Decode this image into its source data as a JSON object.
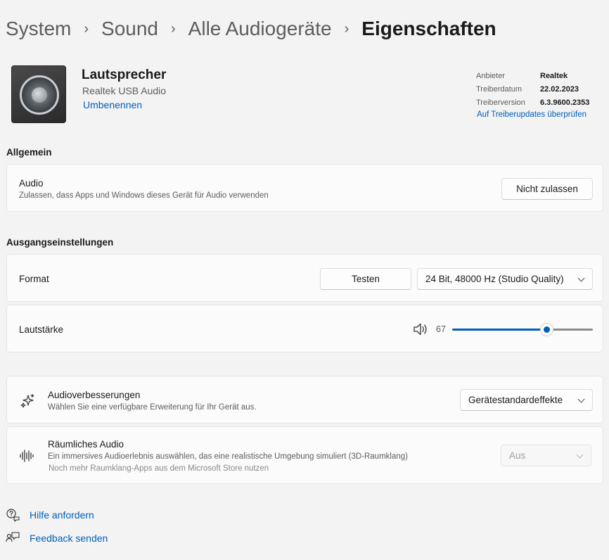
{
  "breadcrumb": {
    "items": [
      "System",
      "Sound",
      "Alle Audiogeräte"
    ],
    "current": "Eigenschaften"
  },
  "device": {
    "name": "Lautsprecher",
    "subtitle": "Realtek USB Audio",
    "rename_link": "Umbenennen",
    "icon": "speaker-icon"
  },
  "driver": {
    "rows": [
      {
        "label": "Anbieter",
        "value": "Realtek"
      },
      {
        "label": "Treiberdatum",
        "value": "22.02.2023"
      },
      {
        "label": "Treiberversion",
        "value": "6.3.9600.2353"
      }
    ],
    "update_link": "Auf Treiberupdates überprüfen"
  },
  "general": {
    "title": "Allgemein",
    "audio": {
      "title": "Audio",
      "description": "Zulassen, dass Apps und Windows dieses Gerät für Audio verwenden",
      "button": "Nicht zulassen"
    }
  },
  "output": {
    "title": "Ausgangseinstellungen",
    "format": {
      "label": "Format",
      "test_button": "Testen",
      "selected": "24 Bit, 48000 Hz (Studio Quality)"
    },
    "volume": {
      "label": "Lautstärke",
      "value": "67",
      "percent": 67
    }
  },
  "enhancements": {
    "title": "Audioverbesserungen",
    "description": "Wählen Sie eine verfügbare Erweiterung für Ihr Gerät aus.",
    "selected": "Gerätestandardeffekte",
    "icon": "sparkle-icon"
  },
  "spatial": {
    "title": "Räumliches Audio",
    "description": "Ein immersives Audioerlebnis auswählen, das eine realistische Umgebung simuliert (3D-Raumklang)",
    "store_note": "Noch mehr Raumklang-Apps aus dem Microsoft Store nutzen",
    "selected": "Aus",
    "icon": "sound-wave-icon"
  },
  "footer": {
    "help": "Hilfe anfordern",
    "feedback": "Feedback senden"
  },
  "colors": {
    "accent": "#005fb8",
    "background": "#f3f3f3",
    "card": "#fbfbfb"
  }
}
